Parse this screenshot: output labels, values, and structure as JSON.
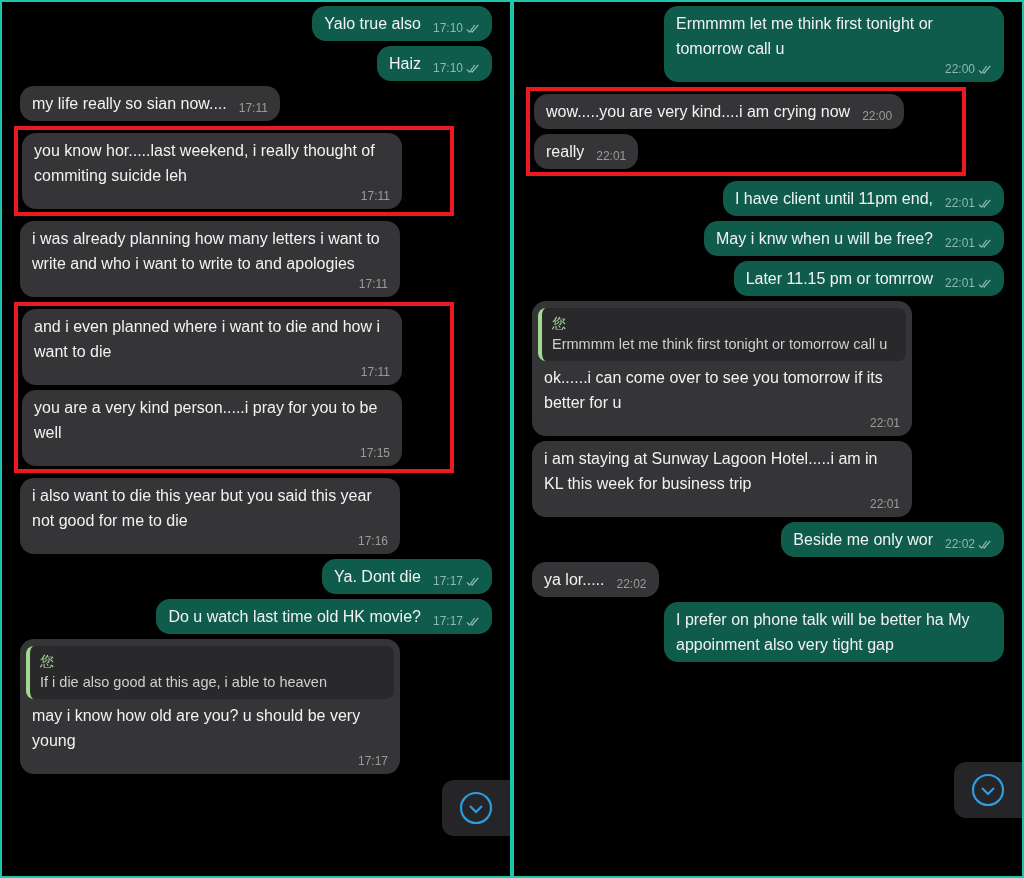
{
  "panels": [
    {
      "messages": [
        {
          "kind": "outgoing",
          "text": "Yalo true also",
          "time": "17:10",
          "read": true,
          "highlighted": false
        },
        {
          "kind": "outgoing",
          "text": "Haiz",
          "time": "17:10",
          "read": true,
          "highlighted": false
        },
        {
          "kind": "incoming",
          "text": "my life really so sian now....",
          "time": "17:11",
          "highlighted": false
        },
        {
          "kind": "incoming",
          "text": "you know hor.....last weekend, i really thought of commiting suicide leh",
          "time": "17:11",
          "highlighted": true
        },
        {
          "kind": "incoming",
          "text": "i was already planning how many letters i want to write and who i want to write to and apologies",
          "time": "17:11",
          "highlighted": false
        },
        {
          "kind": "incoming",
          "text": "and i even planned where i want to die and how i want to die",
          "time": "17:11",
          "highlighted": true
        },
        {
          "kind": "incoming",
          "text": "you are a very kind person.....i pray for you to be well",
          "time": "17:15",
          "highlighted": true
        },
        {
          "kind": "incoming",
          "text": "i also want to die this year but you said this year not good for me to die",
          "time": "17:16",
          "highlighted": false
        },
        {
          "kind": "outgoing",
          "text": "Ya. Dont die",
          "time": "17:17",
          "read": true,
          "highlighted": false
        },
        {
          "kind": "outgoing",
          "text": "Do u watch last time old HK movie?",
          "time": "17:17",
          "read": true,
          "highlighted": false
        },
        {
          "kind": "incoming",
          "quote": {
            "author": "您",
            "text": "If i die also good at this age, i able to heaven"
          },
          "text": "may i know how old are you? u should be very young",
          "time": "17:17",
          "highlighted": false
        }
      ]
    },
    {
      "messages": [
        {
          "kind": "outgoing",
          "text": "Ermmmm let me think first tonight or tomorrow call u",
          "time": "22:00",
          "read": true,
          "highlighted": false
        },
        {
          "kind": "incoming",
          "text": "wow.....you are very kind....i am crying now",
          "time": "22:00",
          "highlighted": true
        },
        {
          "kind": "incoming",
          "text": "really",
          "time": "22:01",
          "highlighted": true
        },
        {
          "kind": "outgoing",
          "text": "I have client until 11pm end,",
          "time": "22:01",
          "read": true,
          "highlighted": false
        },
        {
          "kind": "outgoing",
          "text": "May i knw when u will be free?",
          "time": "22:01",
          "read": true,
          "highlighted": false
        },
        {
          "kind": "outgoing",
          "text": "Later 11.15 pm or tomrrow",
          "time": "22:01",
          "read": true,
          "highlighted": false
        },
        {
          "kind": "incoming",
          "quote": {
            "author": "您",
            "text": "Ermmmm let me think first tonight or tomorrow call u"
          },
          "text": "ok......i can come over to see you tomorrow if its better for u",
          "time": "22:01",
          "highlighted": false
        },
        {
          "kind": "incoming",
          "text": "i am staying at Sunway Lagoon Hotel.....i am in KL this week for business trip",
          "time": "22:01",
          "highlighted": false
        },
        {
          "kind": "outgoing",
          "text": "Beside me only wor",
          "time": "22:02",
          "read": true,
          "highlighted": false
        },
        {
          "kind": "incoming",
          "text": "ya lor.....",
          "time": "22:02",
          "highlighted": false
        },
        {
          "kind": "outgoing",
          "text": "I prefer on phone talk will be better ha My appoinment also very tight gap",
          "highlighted": false
        }
      ]
    }
  ]
}
